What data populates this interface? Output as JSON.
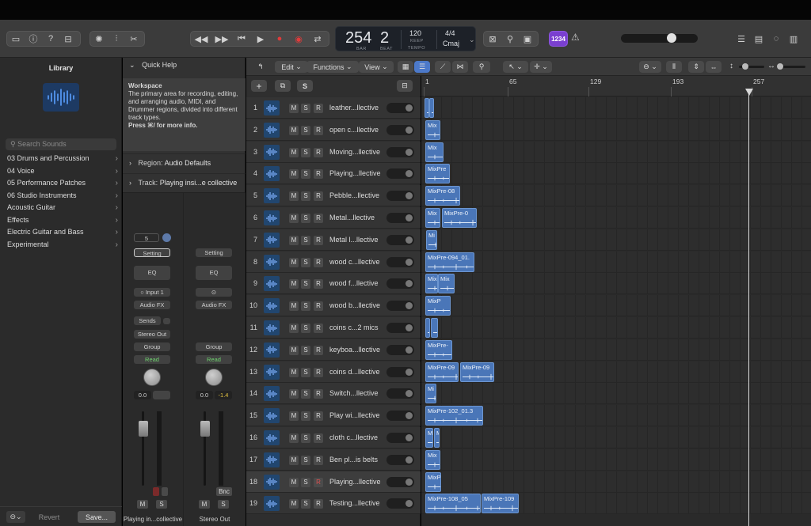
{
  "control_bar": {
    "lcd": {
      "bar": "254",
      "beat": "2",
      "bar_label": "BAR",
      "beat_label": "BEAT",
      "tempo": "120",
      "tempo_keep": "KEEP",
      "tempo_label": "TEMPO",
      "time_sig": "4/4",
      "key": "Cmaj"
    },
    "count_in_badge": "1234"
  },
  "library": {
    "title": "Library",
    "search_placeholder": "Search Sounds",
    "items": [
      "03 Drums and Percussion",
      "04 Voice",
      "05 Performance Patches",
      "06 Studio Instruments",
      "Acoustic Guitar",
      "Effects",
      "Electric Guitar and Bass",
      "Experimental"
    ],
    "revert": "Revert",
    "save": "Save..."
  },
  "inspector": {
    "quick_help_title": "Quick Help",
    "qh_heading": "Workspace",
    "qh_text": "The primary area for recording, editing, and arranging audio, MIDI, and Drummer regions, divided into different track types.",
    "qh_more": "Press ⌘/ for more info.",
    "region_label": "Region:",
    "region_value": "Audio Defaults",
    "track_label": "Track:",
    "track_value": "Playing insi...e collective",
    "strip1": {
      "num": "5",
      "setting": "Setting",
      "eq": "EQ",
      "input": "Input 1",
      "audio_fx": "Audio FX",
      "sends": "Sends",
      "output": "Stereo Out",
      "group": "Group",
      "read": "Read",
      "vol": "0.0",
      "peak": "",
      "m": "M",
      "s": "S",
      "name": "Playing in...collective"
    },
    "strip2": {
      "setting": "Setting",
      "eq": "EQ",
      "audio_fx": "Audio FX",
      "group": "Group",
      "read": "Read",
      "vol": "0.0",
      "peak": "-1.4",
      "bnc": "Bnc",
      "m": "M",
      "s": "S",
      "name": "Stereo Out"
    }
  },
  "tracks_toolbar": {
    "edit": "Edit",
    "functions": "Functions",
    "view": "View",
    "s_button": "S"
  },
  "ruler": [
    "1",
    "65",
    "129",
    "193",
    "257"
  ],
  "track_buttons": {
    "m": "M",
    "s": "S",
    "r": "R"
  },
  "tracks": [
    {
      "num": "1",
      "name": "leather...llective"
    },
    {
      "num": "2",
      "name": "open c...llective"
    },
    {
      "num": "3",
      "name": "Moving...llective"
    },
    {
      "num": "4",
      "name": "Playing...llective"
    },
    {
      "num": "5",
      "name": "Pebble...llective"
    },
    {
      "num": "6",
      "name": "Metal...llective"
    },
    {
      "num": "7",
      "name": "Metal l...llective"
    },
    {
      "num": "8",
      "name": "wood c...llective"
    },
    {
      "num": "9",
      "name": "wood f...llective"
    },
    {
      "num": "10",
      "name": "wood b...llective"
    },
    {
      "num": "11",
      "name": "coins c...2 mics"
    },
    {
      "num": "12",
      "name": "keyboa...llective"
    },
    {
      "num": "13",
      "name": "coins d...llective"
    },
    {
      "num": "14",
      "name": "Switch...llective"
    },
    {
      "num": "15",
      "name": "Play wi...llective"
    },
    {
      "num": "16",
      "name": "cloth c...llective"
    },
    {
      "num": "17",
      "name": "Ben pl...is belts"
    },
    {
      "num": "18",
      "name": "Playing...llective"
    },
    {
      "num": "19",
      "name": "Testing...llective"
    }
  ],
  "regions": [
    [
      {
        "name": ""
      }
    ],
    [
      {
        "name": "Mix"
      }
    ],
    [
      {
        "name": "Mix"
      }
    ],
    [
      {
        "name": "MixPre"
      }
    ],
    [
      {
        "name": "MixPre-08"
      }
    ],
    [
      {
        "name": "Mix"
      },
      {
        "name": "MixPre-0"
      }
    ],
    [
      {
        "name": "Mi"
      }
    ],
    [
      {
        "name": "MixPre-094_01."
      }
    ],
    [
      {
        "name": "Mix"
      },
      {
        "name": "Mix"
      }
    ],
    [
      {
        "name": "MixP"
      }
    ],
    [
      {
        "name": ""
      }
    ],
    [
      {
        "name": "MixPre-"
      }
    ],
    [
      {
        "name": "MixPre-09"
      },
      {
        "name": "MixPre-09"
      }
    ],
    [
      {
        "name": "Mi"
      }
    ],
    [
      {
        "name": "MixPre-102_01.3"
      }
    ],
    [
      {
        "name": "M"
      }
    ],
    [
      {
        "name": "Mix"
      }
    ],
    [
      {
        "name": "MixP"
      }
    ],
    [
      {
        "name": "MixPre-108_05"
      },
      {
        "name": "MixPre-109"
      }
    ]
  ],
  "colors": {
    "region": "#4a76b8",
    "record": "#e03b3b",
    "accent": "#7a3fd0"
  }
}
